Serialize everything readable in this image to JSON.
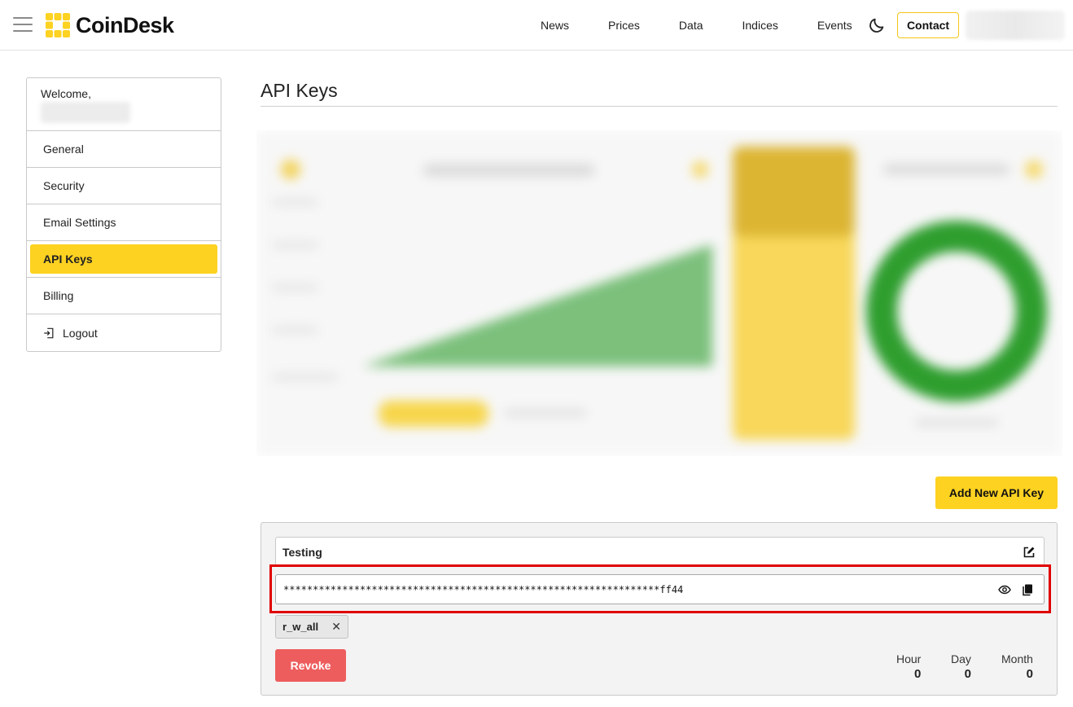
{
  "header": {
    "logo_text": "CoinDesk",
    "nav": [
      "News",
      "Prices",
      "Data",
      "Indices",
      "Events"
    ],
    "contact_label": "Contact"
  },
  "sidebar": {
    "welcome_label": "Welcome,",
    "items": [
      {
        "label": "General",
        "active": false
      },
      {
        "label": "Security",
        "active": false
      },
      {
        "label": "Email Settings",
        "active": false
      },
      {
        "label": "API Keys",
        "active": true
      },
      {
        "label": "Billing",
        "active": false
      },
      {
        "label": "Logout",
        "active": false
      }
    ]
  },
  "main": {
    "title": "API Keys",
    "add_button_label": "Add New API Key",
    "key_card": {
      "name": "Testing",
      "masked_key": "****************************************************************ff44",
      "scope": "r_w_all",
      "scope_remove": "✕",
      "revoke_label": "Revoke",
      "usage": [
        {
          "label": "Hour",
          "value": "0"
        },
        {
          "label": "Day",
          "value": "0"
        },
        {
          "label": "Month",
          "value": "0"
        }
      ]
    }
  },
  "colors": {
    "accent": "#fdd221",
    "danger": "#ee5d5d",
    "highlight": "#e00000",
    "chart_green": "#2e9e2e"
  }
}
